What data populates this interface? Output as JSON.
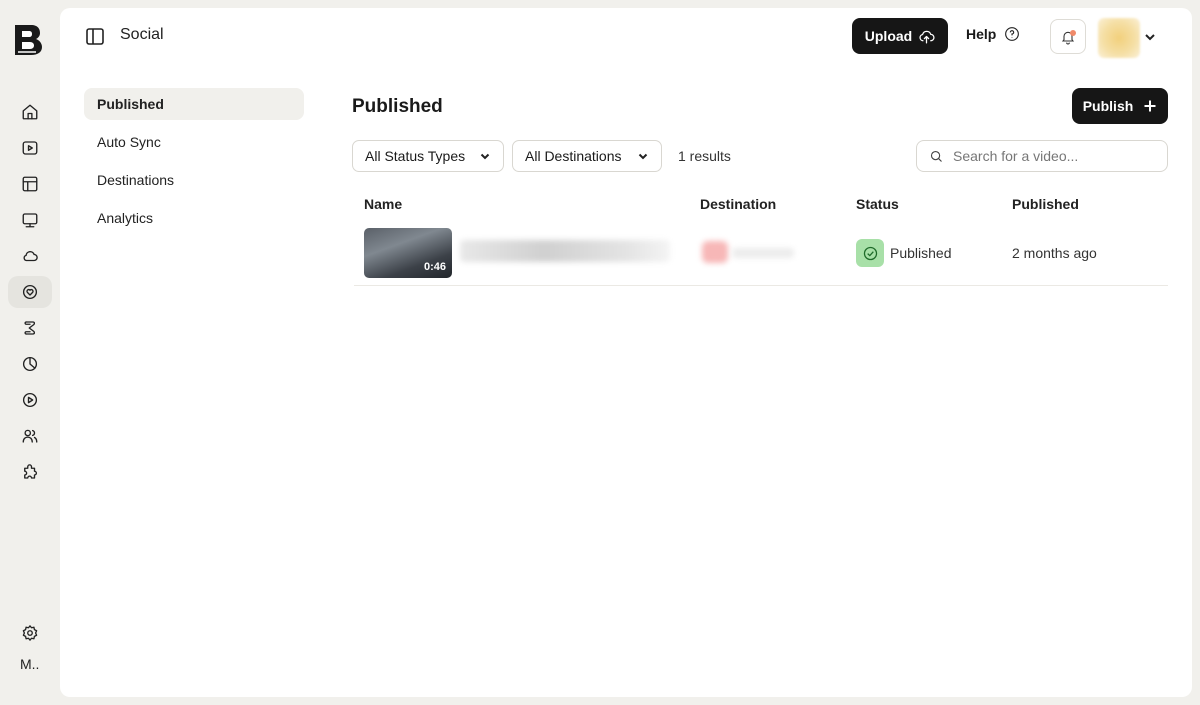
{
  "colors": {
    "page_bg": "#f1f0ec",
    "card_bg": "#ffffff",
    "primary_button": "#161616",
    "status_published_bg": "#a8e0a8"
  },
  "rail": {
    "logo_icon": "brand-b-logo",
    "items": [
      {
        "icon": "home-icon"
      },
      {
        "icon": "video-play-icon"
      },
      {
        "icon": "layout-icon"
      },
      {
        "icon": "monitor-icon"
      },
      {
        "icon": "cloud-icon"
      },
      {
        "icon": "social-icon",
        "active": true
      },
      {
        "icon": "script-icon"
      },
      {
        "icon": "analytics-pie-icon"
      },
      {
        "icon": "play-circle-icon"
      },
      {
        "icon": "users-icon"
      },
      {
        "icon": "puzzle-icon"
      },
      {
        "icon": "settings-icon"
      }
    ],
    "user_label": "M.."
  },
  "topbar": {
    "title": "Social",
    "upload_label": "Upload",
    "help_label": "Help"
  },
  "subnav": {
    "items": [
      {
        "label": "Published",
        "active": true
      },
      {
        "label": "Auto Sync"
      },
      {
        "label": "Destinations"
      },
      {
        "label": "Analytics"
      }
    ]
  },
  "content": {
    "title": "Published",
    "publish_label": "Publish",
    "filters": {
      "status": "All Status Types",
      "destinations": "All Destinations"
    },
    "results": "1 results",
    "search_placeholder": "Search for a video..."
  },
  "table": {
    "columns": [
      "Name",
      "Destination",
      "Status",
      "Published"
    ],
    "rows": [
      {
        "duration": "0:46",
        "status": "Published",
        "published": "2 months ago"
      }
    ]
  }
}
